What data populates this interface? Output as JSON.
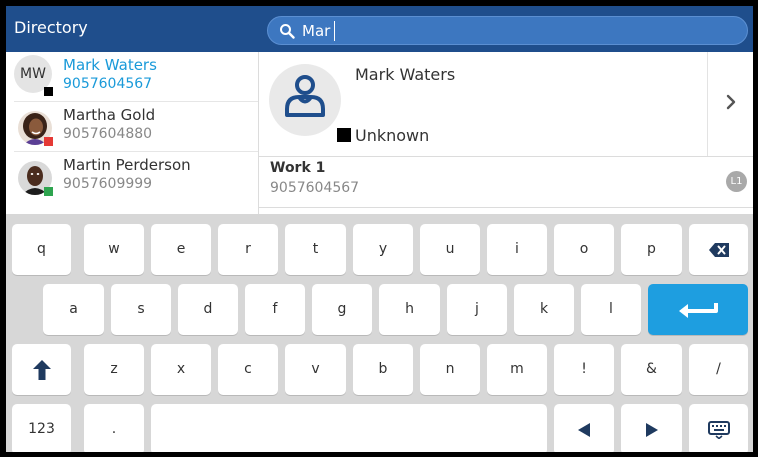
{
  "header": {
    "title": "Directory",
    "search_value": "Mar"
  },
  "contacts": [
    {
      "initials": "MW",
      "name": "Mark Waters",
      "number": "9057604567",
      "presence_color": "#000000",
      "selected": true
    },
    {
      "name": "Martha Gold",
      "number": "9057604880",
      "presence_color": "#e53935"
    },
    {
      "name": "Martin Perderson",
      "number": "9057609999",
      "presence_color": "#2ea44f"
    }
  ],
  "detail": {
    "name": "Mark Waters",
    "status": "Unknown",
    "line_label": "Work 1",
    "line_number": "9057604567",
    "line_badge": "L1"
  },
  "keyboard": {
    "row1": [
      "q",
      "w",
      "e",
      "r",
      "t",
      "y",
      "u",
      "i",
      "o",
      "p"
    ],
    "row2": [
      "a",
      "s",
      "d",
      "f",
      "g",
      "h",
      "j",
      "k",
      "l"
    ],
    "row3": [
      "z",
      "x",
      "c",
      "v",
      "b",
      "n",
      "m",
      "!",
      "&",
      "/"
    ],
    "numbers_key": "123",
    "dot_key": "."
  },
  "colors": {
    "header_bg": "#1f4e8c",
    "search_bg": "#3d77c0",
    "accent": "#1a9ad9",
    "enter_key": "#1e9ee0"
  }
}
